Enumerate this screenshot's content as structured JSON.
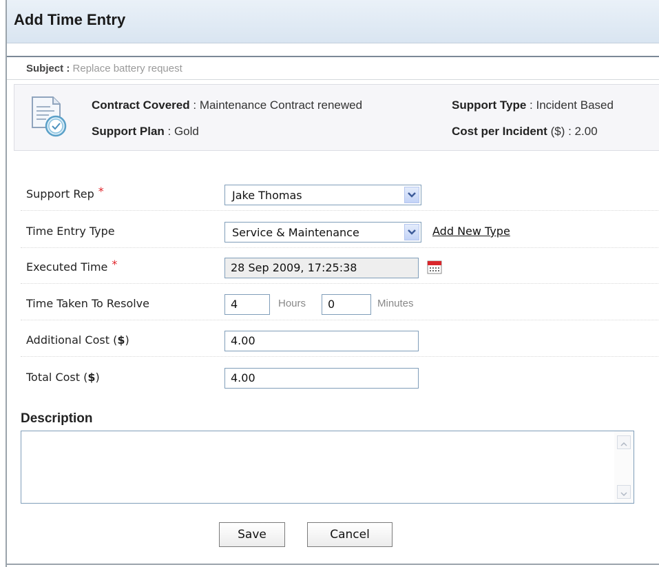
{
  "window": {
    "title": "Add Time Entry"
  },
  "subject": {
    "label": "Subject :",
    "value": "Replace battery request"
  },
  "contract": {
    "icon": "contract-clock-icon",
    "contract_covered_label": "Contract Covered",
    "contract_covered_value": ": Maintenance Contract renewed",
    "support_plan_label": "Support Plan",
    "support_plan_value": ": Gold",
    "support_type_label": "Support Type",
    "support_type_value": ": Incident Based",
    "cost_per_incident_label": "Cost per Incident",
    "cost_per_incident_unit": "($)",
    "cost_per_incident_value": ": 2.00"
  },
  "form": {
    "required_marker": "*",
    "support_rep": {
      "label": "Support Rep",
      "value": "Jake Thomas"
    },
    "time_entry_type": {
      "label": "Time Entry Type",
      "value": "Service & Maintenance",
      "add_link": "Add New Type"
    },
    "executed_time": {
      "label": "Executed Time",
      "value": "28 Sep 2009, 17:25:38"
    },
    "time_taken": {
      "label": "Time Taken To Resolve",
      "hours_value": "4",
      "hours_unit": "Hours",
      "minutes_value": "0",
      "minutes_unit": "Minutes"
    },
    "additional_cost": {
      "label": "Additional Cost (",
      "currency": "$",
      "label_end": ")",
      "value": "4.00"
    },
    "total_cost": {
      "label": "Total Cost (",
      "currency": "$",
      "label_end": ")",
      "value": "4.00"
    }
  },
  "description": {
    "heading": "Description",
    "value": ""
  },
  "actions": {
    "save_label": "Save",
    "cancel_label": "Cancel"
  },
  "colors": {
    "required": "#e0242a",
    "title_bar": "#dde7f2",
    "panel_bg": "#f6f6f9",
    "input_border": "#7f9db9"
  }
}
